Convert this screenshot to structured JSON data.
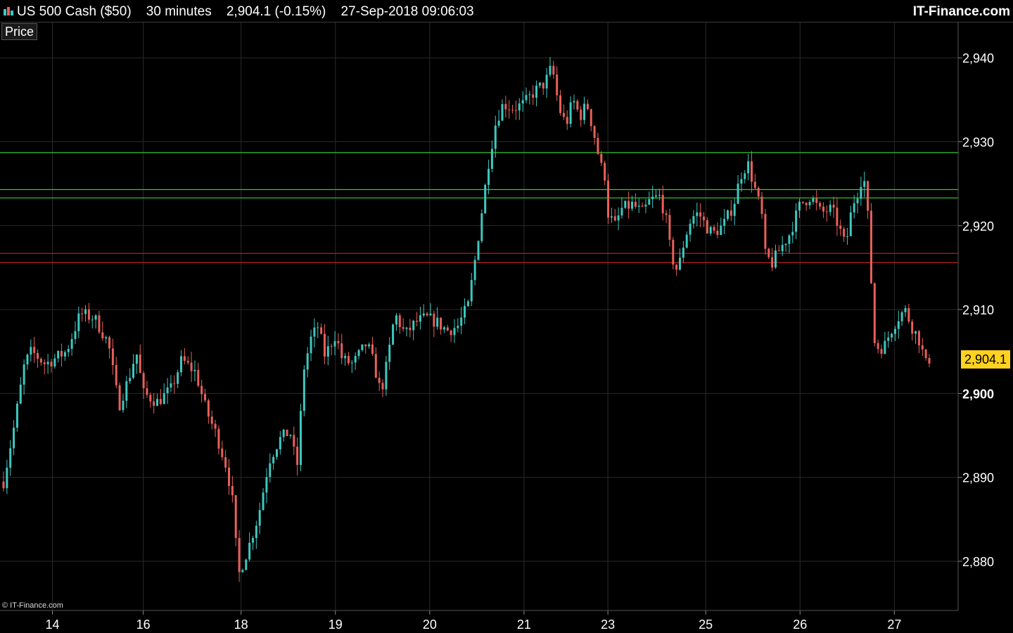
{
  "header": {
    "symbol": "US 500 Cash ($50)",
    "timeframe": "30 minutes",
    "last_price": "2,904.1 (-0.15%)",
    "datetime": "27-Sep-2018 09:06:03",
    "brand": "IT-Finance.com"
  },
  "panel_label": "Price",
  "copyright": "© IT-Finance.com",
  "last_badge": "2,904.1",
  "colors": {
    "up": "#3ec8c0",
    "down": "#e8605a",
    "support": "#33cc33",
    "resistance": "#cc2222",
    "badge": "#ffd21f",
    "grid": "#2a2a2a"
  },
  "chart_data": {
    "type": "candlestick",
    "ylim": [
      2874,
      2944
    ],
    "y_ticks": [
      {
        "value": 2880,
        "label": "2,880"
      },
      {
        "value": 2890,
        "label": "2,890"
      },
      {
        "value": 2900,
        "label": "2,900"
      },
      {
        "value": 2910,
        "label": "2,910"
      },
      {
        "value": 2920,
        "label": "2,920"
      },
      {
        "value": 2930,
        "label": "2,930"
      },
      {
        "value": 2940,
        "label": "2,940"
      }
    ],
    "x_ticks": [
      {
        "label": "14",
        "index": 14
      },
      {
        "label": "16",
        "index": 40
      },
      {
        "label": "18",
        "index": 68
      },
      {
        "label": "19",
        "index": 95
      },
      {
        "label": "20",
        "index": 122
      },
      {
        "label": "21",
        "index": 149
      },
      {
        "label": "23",
        "index": 173
      },
      {
        "label": "25",
        "index": 201
      },
      {
        "label": "26",
        "index": 228
      },
      {
        "label": "27",
        "index": 255
      }
    ],
    "x_points": 272,
    "levels": [
      {
        "value": 2928.7,
        "type": "support"
      },
      {
        "value": 2924.3,
        "type": "support"
      },
      {
        "value": 2923.3,
        "type": "support"
      },
      {
        "value": 2916.7,
        "type": "resistance"
      },
      {
        "value": 2915.6,
        "type": "resistance"
      }
    ],
    "anchors": [
      [
        0,
        2889.5
      ],
      [
        3,
        2896.0
      ],
      [
        6,
        2903.5
      ],
      [
        8,
        2905.0
      ],
      [
        12,
        2903.5
      ],
      [
        18,
        2905.0
      ],
      [
        22,
        2909.5
      ],
      [
        26,
        2909.0
      ],
      [
        30,
        2906.0
      ],
      [
        33,
        2898.5
      ],
      [
        36,
        2902.0
      ],
      [
        38,
        2905.0
      ],
      [
        40,
        2900.0
      ],
      [
        44,
        2899.0
      ],
      [
        48,
        2900.5
      ],
      [
        51,
        2904.0
      ],
      [
        55,
        2902.5
      ],
      [
        58,
        2898.0
      ],
      [
        61,
        2895.0
      ],
      [
        64,
        2891.0
      ],
      [
        66,
        2886.0
      ],
      [
        67,
        2878.0
      ],
      [
        70,
        2881.5
      ],
      [
        73,
        2885.5
      ],
      [
        76,
        2892.0
      ],
      [
        79,
        2894.5
      ],
      [
        82,
        2895.5
      ],
      [
        84,
        2891.0
      ],
      [
        86,
        2903.0
      ],
      [
        88,
        2906.5
      ],
      [
        90,
        2908.0
      ],
      [
        92,
        2904.5
      ],
      [
        95,
        2907.0
      ],
      [
        97,
        2904.0
      ],
      [
        100,
        2903.5
      ],
      [
        104,
        2906.0
      ],
      [
        106,
        2903.5
      ],
      [
        108,
        2900.0
      ],
      [
        110,
        2904.0
      ],
      [
        112,
        2909.5
      ],
      [
        115,
        2907.0
      ],
      [
        118,
        2908.5
      ],
      [
        121,
        2909.0
      ],
      [
        124,
        2908.5
      ],
      [
        127,
        2907.5
      ],
      [
        130,
        2908.0
      ],
      [
        133,
        2910.5
      ],
      [
        135,
        2916.0
      ],
      [
        137,
        2922.0
      ],
      [
        139,
        2928.0
      ],
      [
        141,
        2932.5
      ],
      [
        143,
        2934.5
      ],
      [
        146,
        2934.0
      ],
      [
        149,
        2934.5
      ],
      [
        152,
        2936.0
      ],
      [
        155,
        2937.0
      ],
      [
        157,
        2939.0
      ],
      [
        159,
        2934.0
      ],
      [
        161,
        2932.0
      ],
      [
        163,
        2935.0
      ],
      [
        165,
        2933.0
      ],
      [
        167,
        2934.5
      ],
      [
        169,
        2931.0
      ],
      [
        171,
        2927.0
      ],
      [
        172,
        2926.5
      ],
      [
        173,
        2921.5
      ],
      [
        175,
        2920.0
      ],
      [
        177,
        2922.0
      ],
      [
        180,
        2922.5
      ],
      [
        183,
        2921.5
      ],
      [
        185,
        2923.0
      ],
      [
        188,
        2923.5
      ],
      [
        190,
        2920.0
      ],
      [
        191,
        2916.5
      ],
      [
        193,
        2914.5
      ],
      [
        195,
        2918.5
      ],
      [
        197,
        2921.0
      ],
      [
        199,
        2921.5
      ],
      [
        201,
        2920.0
      ],
      [
        203,
        2919.0
      ],
      [
        206,
        2920.0
      ],
      [
        209,
        2922.5
      ],
      [
        211,
        2926.0
      ],
      [
        213,
        2927.5
      ],
      [
        215,
        2924.5
      ],
      [
        217,
        2921.5
      ],
      [
        218,
        2916.5
      ],
      [
        220,
        2915.5
      ],
      [
        222,
        2917.0
      ],
      [
        225,
        2919.0
      ],
      [
        228,
        2922.5
      ],
      [
        231,
        2923.5
      ],
      [
        234,
        2921.5
      ],
      [
        237,
        2922.0
      ],
      [
        239,
        2920.0
      ],
      [
        241,
        2917.5
      ],
      [
        243,
        2922.5
      ],
      [
        245,
        2924.5
      ],
      [
        246,
        2926.5
      ],
      [
        247,
        2923.5
      ],
      [
        248,
        2917.5
      ],
      [
        249,
        2906.5
      ],
      [
        250,
        2905.5
      ],
      [
        252,
        2905.5
      ],
      [
        254,
        2907.5
      ],
      [
        256,
        2909.0
      ],
      [
        258,
        2910.0
      ],
      [
        260,
        2908.0
      ],
      [
        262,
        2906.5
      ],
      [
        264,
        2903.5
      ],
      [
        265,
        2904.1
      ]
    ]
  }
}
